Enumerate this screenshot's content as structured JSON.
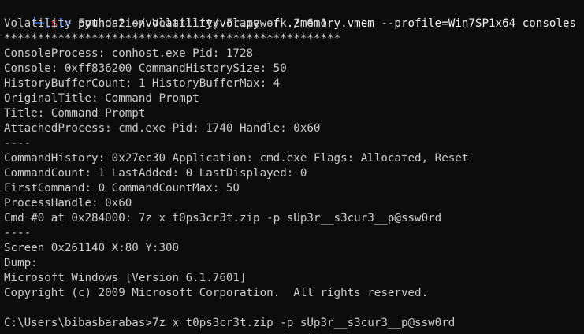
{
  "prompt": {
    "branch": "└─[",
    "dollar": "$",
    "close": "]>",
    "command": " python2 ~/volatility/vol.py -f ./memory.vmem --profile=Win7SP1x64 consoles"
  },
  "output_lines": [
    "Volatility Foundation Volatility Framework 2.6.1",
    "**************************************************",
    "ConsoleProcess: conhost.exe Pid: 1728",
    "Console: 0xff836200 CommandHistorySize: 50",
    "HistoryBufferCount: 1 HistoryBufferMax: 4",
    "OriginalTitle: Command Prompt",
    "Title: Command Prompt",
    "AttachedProcess: cmd.exe Pid: 1740 Handle: 0x60",
    "----",
    "CommandHistory: 0x27ec30 Application: cmd.exe Flags: Allocated, Reset",
    "CommandCount: 1 LastAdded: 0 LastDisplayed: 0",
    "FirstCommand: 0 CommandCountMax: 50",
    "ProcessHandle: 0x60",
    "Cmd #0 at 0x284000: 7z x t0ps3cr3t.zip -p sUp3r__s3cur3__p@ssw0rd",
    "----",
    "Screen 0x261140 X:80 Y:300",
    "Dump:",
    "Microsoft Windows [Version 6.1.7601]",
    "Copyright (c) 2009 Microsoft Corporation.  All rights reserved.",
    "",
    "C:\\Users\\bibasbarabas>7z x t0ps3cr3t.zip -p sUp3r__s3cur3__p@ssw0rd"
  ]
}
